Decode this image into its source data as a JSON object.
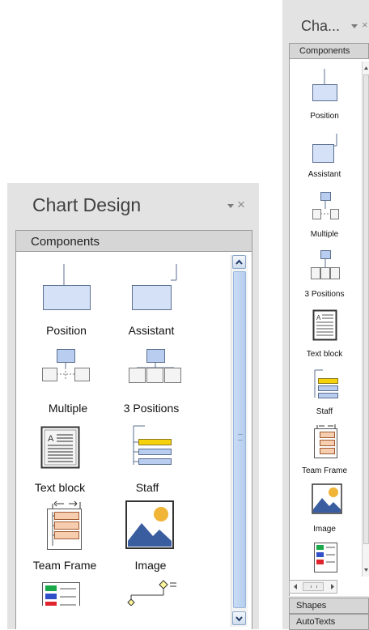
{
  "panel_large": {
    "title": "Chart Design",
    "close_glyph": "×",
    "section": "Components",
    "items": [
      "Position",
      "Assistant",
      "Multiple",
      "3 Positions",
      "Text block",
      "Staff",
      "Team Frame",
      "Image"
    ]
  },
  "panel_small": {
    "title": "Cha...",
    "close_glyph": "×",
    "section": "Components",
    "items": [
      "Position",
      "Assistant",
      "Multiple",
      "3 Positions",
      "Text block",
      "Staff",
      "Team Frame",
      "Image"
    ],
    "footer_sections": [
      "Shapes",
      "AutoTexts"
    ]
  },
  "colors": {
    "panel_bg": "#e3e3e3",
    "box_fill": "#d4e1f7",
    "box_stroke": "#5b6f8f",
    "staff_yellow": "#f5d20b",
    "team_orange": "#f7cdb0",
    "image_sun": "#f0b437",
    "image_mountain": "#3a5da0",
    "list_green": "#1aa84a",
    "list_blue": "#3050c8",
    "list_red": "#e0242e",
    "diamond_yellow": "#fff59a"
  }
}
